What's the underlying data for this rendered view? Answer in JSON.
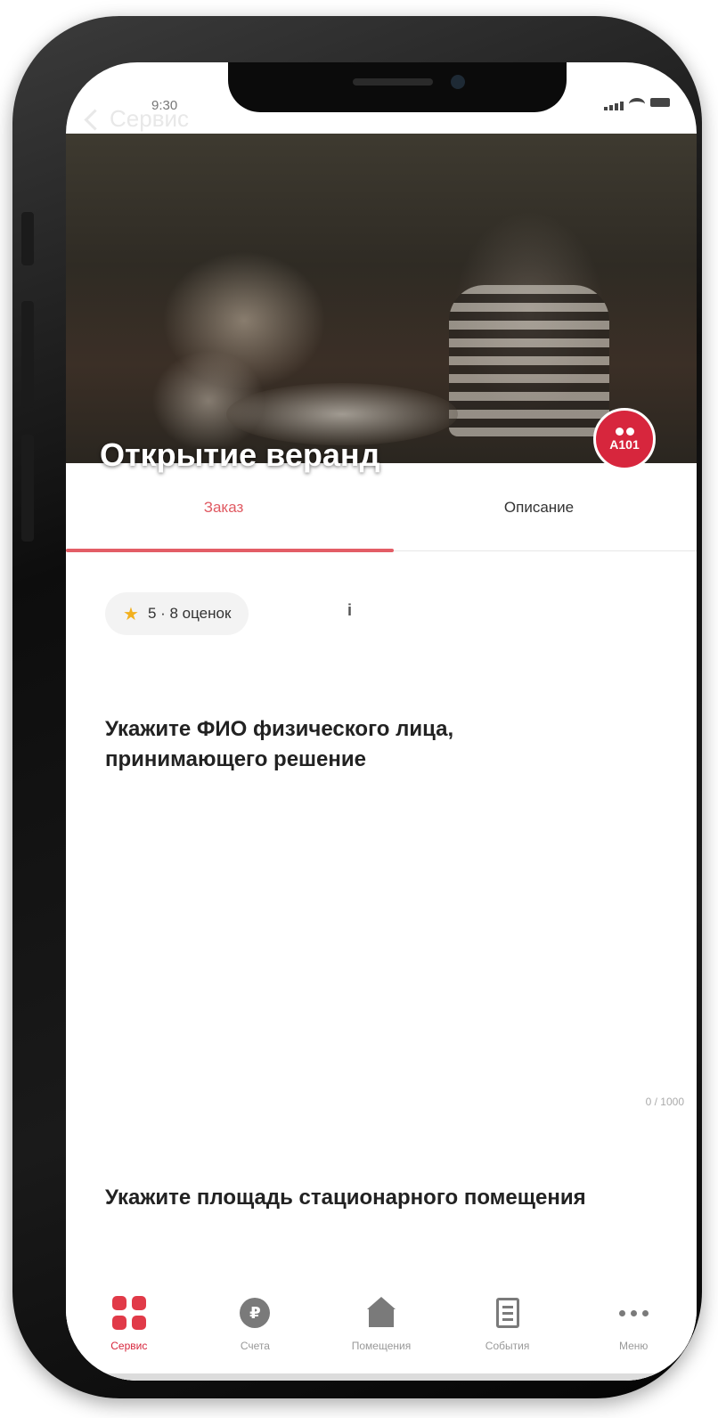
{
  "status_bar": {
    "time": "9:30"
  },
  "header": {
    "back_label": "Сервис",
    "title": "Открытие веранд",
    "brand_badge": "A101"
  },
  "tabs": [
    {
      "label": "Заказ",
      "active": true
    },
    {
      "label": "Описание",
      "active": false
    }
  ],
  "rating": {
    "text": "5 · 8 оценок",
    "info_icon": "i"
  },
  "form": {
    "question_1": "Укажите ФИО физического лица, принимающего решение",
    "counter_1": "0 / 1000",
    "question_2": "Укажите площадь стационарного помещения"
  },
  "bottom_nav": [
    {
      "label": "Сервис",
      "icon": "grid-icon",
      "active": true
    },
    {
      "label": "Счета",
      "icon": "coin-icon",
      "active": false
    },
    {
      "label": "Помещения",
      "icon": "house-icon",
      "active": false
    },
    {
      "label": "События",
      "icon": "document-icon",
      "active": false
    },
    {
      "label": "Меню",
      "icon": "more-icon",
      "active": false
    }
  ],
  "colors": {
    "accent": "#d7263d",
    "tab_active": "#e05a62",
    "icon_inactive": "#7a7a7a"
  }
}
